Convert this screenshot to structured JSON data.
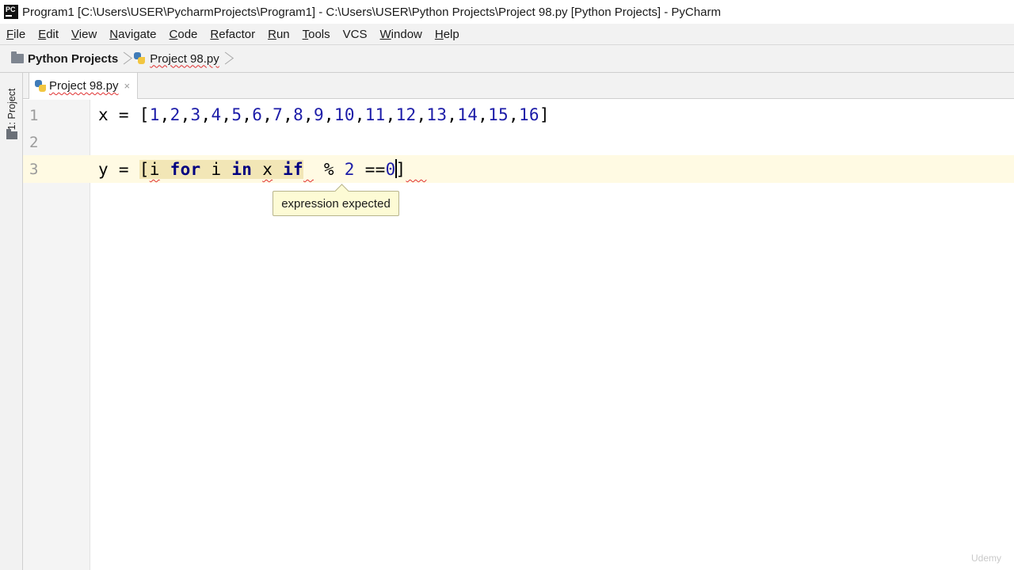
{
  "window": {
    "title": "Program1 [C:\\Users\\USER\\PycharmProjects\\Program1] - C:\\Users\\USER\\Python Projects\\Project 98.py [Python Projects] - PyCharm",
    "app_icon": "pycharm-logo",
    "app_icon_text": "PC"
  },
  "menu": {
    "items": [
      {
        "mnemonic": "F",
        "rest": "ile"
      },
      {
        "mnemonic": "E",
        "rest": "dit"
      },
      {
        "mnemonic": "V",
        "rest": "iew"
      },
      {
        "mnemonic": "N",
        "rest": "avigate"
      },
      {
        "mnemonic": "C",
        "rest": "ode"
      },
      {
        "mnemonic": "R",
        "rest": "efactor"
      },
      {
        "mnemonic": "R",
        "rest": "un",
        "pre": "",
        "display": "Run"
      },
      {
        "mnemonic": "T",
        "rest": "ools"
      },
      {
        "mnemonic": "",
        "rest": "VCS"
      },
      {
        "mnemonic": "W",
        "rest": "indow"
      },
      {
        "mnemonic": "H",
        "rest": "elp"
      }
    ]
  },
  "breadcrumb": {
    "project": "Python Projects",
    "file": "Project 98.py"
  },
  "toolstrip": {
    "project_label": "1: Project"
  },
  "tab": {
    "label": "Project 98.py",
    "close": "×"
  },
  "editor": {
    "line_numbers": [
      "1",
      "2",
      "3"
    ],
    "line1": {
      "prefix": "x = [",
      "numbers": [
        "1",
        "2",
        "3",
        "4",
        "5",
        "6",
        "7",
        "8",
        "9",
        "10",
        "11",
        "12",
        "13",
        "14",
        "15",
        "16"
      ],
      "suffix": "]"
    },
    "line3": {
      "open": "[",
      "i1": "i",
      "kw_for": "for",
      "i2": "i",
      "kw_in": "in",
      "x": "x",
      "kw_if": "if",
      "mod": "%",
      "two": "2",
      "eq": "==",
      "zero": "0",
      "close": "]",
      "lhs": "y = "
    }
  },
  "tooltip": {
    "text": "expression expected"
  },
  "watermark": {
    "text": "Udemy"
  }
}
